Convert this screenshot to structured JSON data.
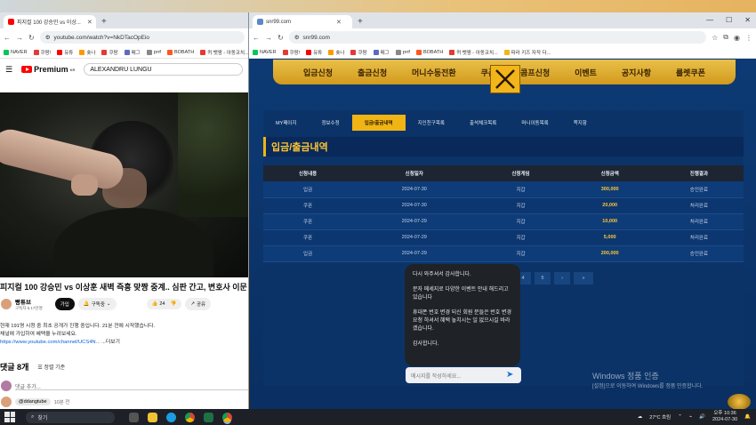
{
  "left_browser": {
    "tab_title": "피지컬 100 강승민 vs 이상...",
    "url": "youtube.com/watch?v=NkDTacOpEio",
    "bookmarks": [
      "NAVER",
      "쿠팡!",
      "유튜",
      "숏나",
      "쿠팡",
      "메그",
      "prrf",
      "BOBATH",
      "퀴 뱃왕 - 아동코치..."
    ],
    "search_value": "ALEXANDRU LUNGU",
    "logo_text": "Premium",
    "logo_sup": "KR",
    "video_title": "피지컬 100 강승민 vs 이상훈 새벽 즉흥 맞짱 중계.. 심판 간고, 변호사 이문",
    "channel_name": "빵튜브",
    "channel_subs": "구독자 5.17만명",
    "join_label": "가입",
    "subscribe_label": "구독중",
    "like_count": "24",
    "share_label": "공유",
    "desc_line1": "현재 191명 시청 중 최초 공개가 진행 중입니다. 21분 전에 시작했습니다.",
    "desc_line2": "채널에 가입하여 혜택을 누려보세요.",
    "desc_link": "https://www.youtube.com/channel/UCS4N...",
    "desc_more": "...더보기",
    "comments_count": "댓글 8개",
    "sort_label": "정렬 기준",
    "comment_placeholder": "댓글 추가...",
    "first_comment_handle": "@ddangtube",
    "first_comment_time": "10분 전"
  },
  "right_browser": {
    "tab_title": "snr99.com",
    "url": "snr99.com",
    "bookmarks": [
      "NAVER",
      "쿠팡!",
      "유튜",
      "숏나",
      "쿠팡",
      "메그",
      "prrf",
      "BOBATH",
      "퀴 뱃왕 - 아동코치...",
      "파라 키즈 자작 다..."
    ],
    "nav_items": [
      "입금신청",
      "출금신청",
      "머니수동전환",
      "쿠폰",
      "콤프신청",
      "이벤트",
      "공지사항",
      "룰렛쿠폰"
    ],
    "sub_tabs": [
      "MY페이지",
      "정보수정",
      "입금/출금내역",
      "지인친구목록",
      "출석체크목록",
      "머니이동목록",
      "쪽지함"
    ],
    "active_sub_tab": 2,
    "section_title": "입금/출금내역",
    "table": {
      "headers": [
        "신청내용",
        "신청일자",
        "신청게임",
        "신청금액",
        "진행결과"
      ],
      "rows": [
        [
          "입금",
          "2024-07-30",
          "지갑",
          "300,000",
          "승인완료"
        ],
        [
          "쿠폰",
          "2024-07-30",
          "지갑",
          "20,000",
          "처리완료"
        ],
        [
          "쿠폰",
          "2024-07-29",
          "지갑",
          "10,000",
          "처리완료"
        ],
        [
          "쿠폰",
          "2024-07-29",
          "지갑",
          "5,000",
          "처리완료"
        ],
        [
          "입금",
          "2024-07-29",
          "지갑",
          "200,000",
          "승인완료"
        ]
      ]
    },
    "pager": [
      "«",
      "‹",
      "1",
      "2",
      "3",
      "4",
      "5",
      "›",
      "»"
    ],
    "active_page": 2
  },
  "chat": {
    "messages": [
      "다시 와주셔서 감사합니다.",
      "문자 메세지로 다양한 이벤트 안내 해드리고 있습니다",
      "휴대폰 번호 변경 되신 회원 분들은 번호 변경 요청 하셔서 혜택 놓치시는 일 없으시길 바라겠습니다.",
      "감사합니다."
    ],
    "input_placeholder": "메시지를 작성하세요..."
  },
  "watermark": {
    "line1": "Windows 정품 인증",
    "line2": "[설정]으로 이동하여 Windows를 정품 인증합니다."
  },
  "taskbar": {
    "search_label": "찾기",
    "weather": "27°C 흐림",
    "time": "오후 10:36",
    "date": "2024-07-30"
  }
}
